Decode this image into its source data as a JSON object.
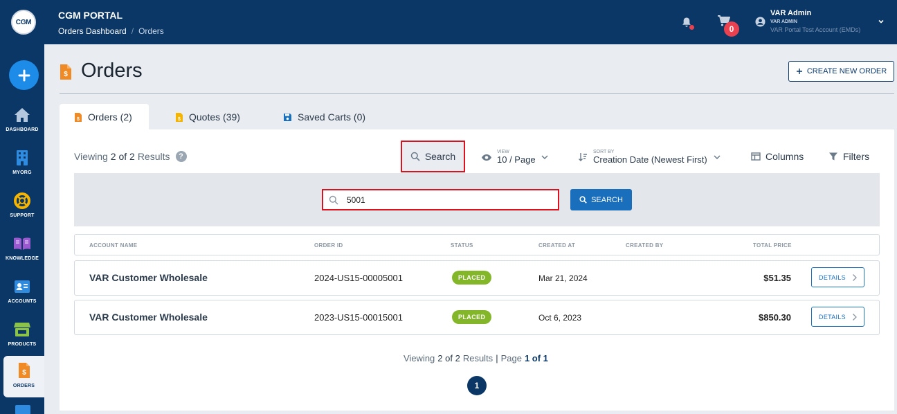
{
  "header": {
    "logo_text": "CGM",
    "portal_title": "CGM PORTAL",
    "breadcrumb": {
      "link": "Orders Dashboard",
      "separator": "/",
      "current": "Orders"
    },
    "cart_count": "0",
    "user": {
      "name": "VAR Admin",
      "role": "VAR ADMIN",
      "account": "VAR Portal Test Account (EMDs)"
    }
  },
  "sidebar": {
    "items": [
      {
        "label": "DASHBOARD",
        "icon": "home-icon"
      },
      {
        "label": "MYORG",
        "icon": "building-icon"
      },
      {
        "label": "SUPPORT",
        "icon": "lifebuoy-icon"
      },
      {
        "label": "KNOWLEDGE",
        "icon": "book-icon"
      },
      {
        "label": "ACCOUNTS",
        "icon": "id-card-icon"
      },
      {
        "label": "PRODUCTS",
        "icon": "store-icon"
      },
      {
        "label": "ORDERS",
        "icon": "invoice-icon",
        "active": true
      }
    ]
  },
  "page": {
    "title": "Orders",
    "create_button": "CREATE NEW ORDER"
  },
  "tabs": [
    {
      "label": "Orders (2)",
      "active": true
    },
    {
      "label": "Quotes (39)",
      "active": false
    },
    {
      "label": "Saved Carts (0)",
      "active": false
    }
  ],
  "toolbar": {
    "viewing_prefix": "Viewing",
    "viewing_count": "2 of 2",
    "viewing_suffix": "Results",
    "help": "?",
    "search_label": "Search",
    "view_small": "VIEW",
    "view_value": "10 / Page",
    "sort_small": "SORT BY",
    "sort_value": "Creation Date (Newest First)",
    "columns_label": "Columns",
    "filters_label": "Filters"
  },
  "search": {
    "value": "5001",
    "button_label": "SEARCH"
  },
  "table": {
    "headers": [
      "ACCOUNT NAME",
      "ORDER ID",
      "STATUS",
      "CREATED AT",
      "CREATED BY",
      "TOTAL PRICE"
    ],
    "rows": [
      {
        "account": "VAR Customer Wholesale",
        "order_id": "2024-US15-00005001",
        "status": "PLACED",
        "created_at": "Mar 21, 2024",
        "created_by": "",
        "total": "$51.35",
        "action": "DETAILS"
      },
      {
        "account": "VAR Customer Wholesale",
        "order_id": "2023-US15-00015001",
        "status": "PLACED",
        "created_at": "Oct 6, 2023",
        "created_by": "",
        "total": "$850.30",
        "action": "DETAILS"
      }
    ]
  },
  "footer": {
    "viewing_prefix": "Viewing",
    "viewing_count": "2 of 2",
    "viewing_suffix": "Results",
    "separator": "|",
    "page_prefix": "Page",
    "page_value": "1 of 1",
    "current_page": "1"
  },
  "colors": {
    "navy": "#0b3767",
    "accent_blue": "#1a6fbd",
    "status_green": "#84b629",
    "alert_red": "#e9414f",
    "highlight_red": "#d9121f",
    "orange_icon": "#f08a24"
  }
}
